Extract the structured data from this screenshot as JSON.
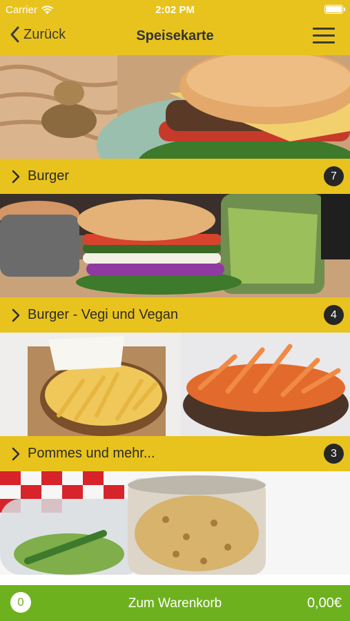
{
  "status_bar": {
    "carrier": "Carrier",
    "time": "2:02 PM"
  },
  "nav": {
    "back_label": "Zurück",
    "title": "Speisekarte",
    "menu_icon": "hamburger-menu-icon"
  },
  "categories": [
    {
      "label": "Burger",
      "count": "7"
    },
    {
      "label": "Burger - Vegi und Vegan",
      "count": "4"
    },
    {
      "label": "Pommes und mehr...",
      "count": "3"
    }
  ],
  "footer": {
    "quantity": "0",
    "label": "Zum Warenkorb",
    "total": "0,00€"
  },
  "colors": {
    "accent_yellow": "#e9c31d",
    "cart_green": "#6eb11e",
    "badge_dark": "#262626"
  }
}
